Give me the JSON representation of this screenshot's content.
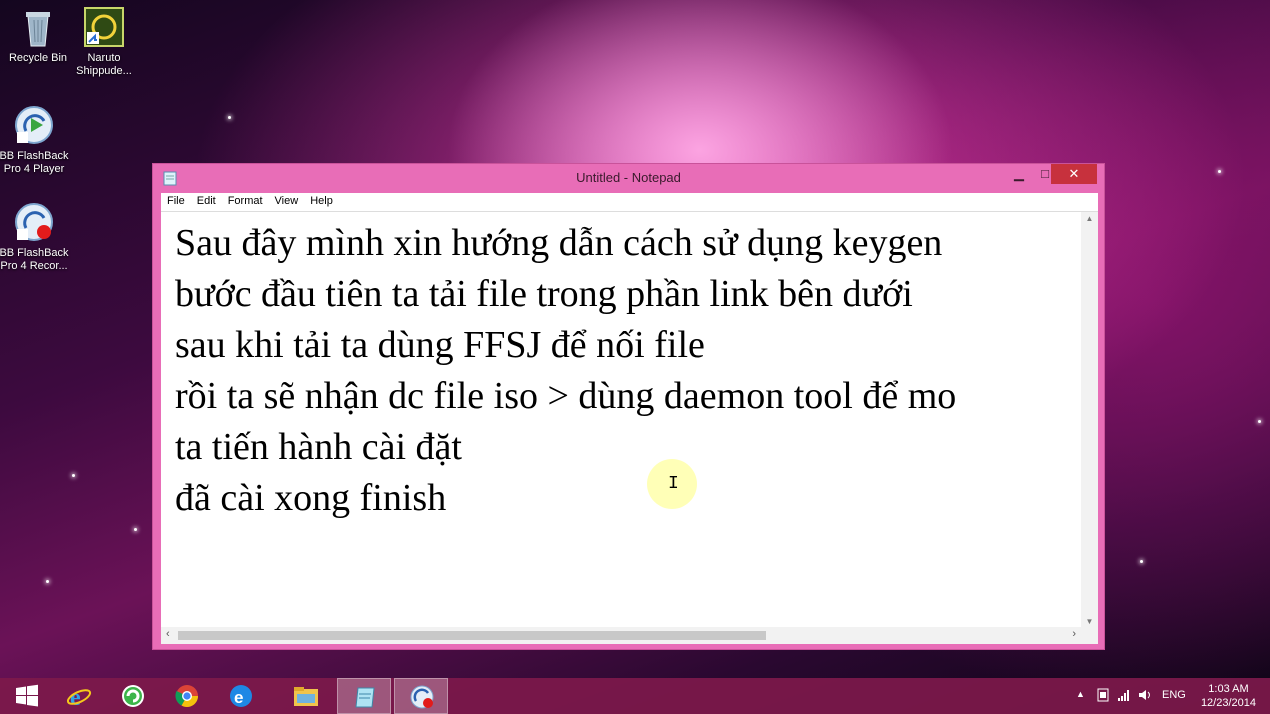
{
  "desktop": {
    "icons": [
      {
        "label": "Recycle Bin"
      },
      {
        "label": "Naruto Shippude..."
      },
      {
        "label": "BB FlashBack Pro 4 Player"
      },
      {
        "label": "BB FlashBack Pro 4 Recor..."
      }
    ]
  },
  "window": {
    "title": "Untitled - Notepad",
    "menu": [
      "File",
      "Edit",
      "Format",
      "View",
      "Help"
    ],
    "text": "Sau đây mình xin hướng dẫn cách sử dụng keygen\nbước đầu tiên ta tải file trong phần link bên dưới\nsau khi tải ta dùng FFSJ để nối file\nrồi ta sẽ nhận dc file iso > dùng daemon tool để mo\nta tiến hành cài đặt\nđã cài xong finish",
    "cursor_glyph": "I",
    "buttons": {
      "minimize": "▁",
      "maximize": "□",
      "close": "✕"
    }
  },
  "taskbar": {
    "apps": [
      "windows-start",
      "internet-explorer",
      "coc-coc",
      "chrome",
      "ie-alt",
      "file-explorer",
      "notepad",
      "bb-flashback"
    ],
    "tray": {
      "arrow": "▲",
      "language": "ENG",
      "time": "1:03 AM",
      "date": "12/23/2014"
    }
  },
  "colors": {
    "accent": "#e86db7",
    "close": "#c7313d",
    "taskbar": "#7d194b"
  }
}
